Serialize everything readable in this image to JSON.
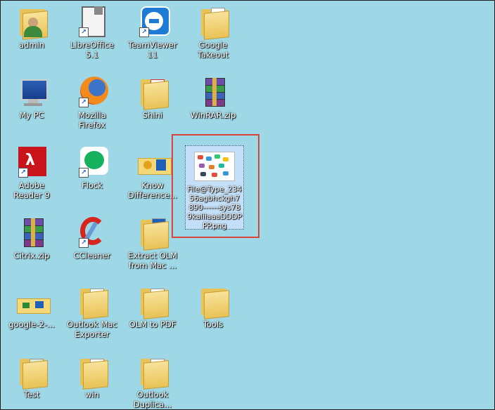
{
  "desktop": {
    "icons": [
      {
        "label": "admin"
      },
      {
        "label": "LibreOffice 5.1"
      },
      {
        "label": "TeamViewer 11"
      },
      {
        "label": "Google Takeout"
      },
      {
        "label": "My PC"
      },
      {
        "label": "Mozilla Firefox"
      },
      {
        "label": "Shini"
      },
      {
        "label": "WinRAR.zip"
      },
      {
        "label": "Adobe Reader 9"
      },
      {
        "label": "Flock"
      },
      {
        "label": "Know Difference..."
      },
      {
        "label": "Citrix.zip"
      },
      {
        "label": "CCleaner"
      },
      {
        "label": "Extract OLM from Mac ..."
      },
      {
        "label": "google-2-..."
      },
      {
        "label": "Outlook Mac Exporter"
      },
      {
        "label": "OLM to PDF"
      },
      {
        "label": "Tools"
      },
      {
        "label": "Test"
      },
      {
        "label": "win"
      },
      {
        "label": "Outlook Duplica..."
      }
    ],
    "selected_file": {
      "label": "File@Type_23456agbhckgh7890------sys789kaliiaaaDDDPPP.png"
    }
  },
  "icon_names": {
    "folder": "folder-icon",
    "user": "user-icon",
    "zip": "winrar-zip-icon"
  }
}
